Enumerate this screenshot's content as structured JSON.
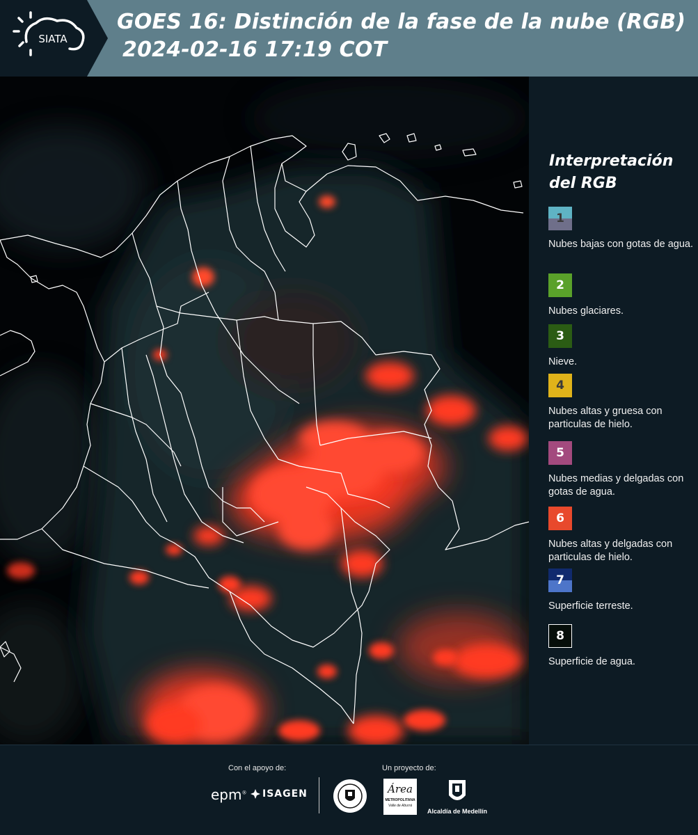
{
  "header": {
    "title_line1": "GOES 16: Distinción de la fase de la nube (RGB)",
    "title_line2": "2024-02-16 17:19 COT",
    "logo_text": "SIATA",
    "background_color": "#5f7f8b",
    "logo_panel_color": "#0d1b24"
  },
  "legend": {
    "title": "Interpretación del RGB",
    "items": [
      {
        "number": "1",
        "color_top": "#5fb3c4",
        "color_bottom": "#6f6f8a",
        "number_color": "#3a3a3a",
        "text": "Nubes bajas con gotas de agua."
      },
      {
        "number": "2",
        "color_top": "#5aa12a",
        "color_bottom": "#5aa12a",
        "number_color": "#ffffff",
        "text": "Nubes glaciares."
      },
      {
        "number": "3",
        "color_top": "#2b5c14",
        "color_bottom": "#2b5c14",
        "number_color": "#ffffff",
        "text": "Nieve."
      },
      {
        "number": "4",
        "color_top": "#e0b31a",
        "color_bottom": "#e0b31a",
        "number_color": "#3a3a3a",
        "text": "Nubes altas y gruesa con particulas de hielo."
      },
      {
        "number": "5",
        "color_top": "#a34a7e",
        "color_bottom": "#a34a7e",
        "number_color": "#ffffff",
        "text": "Nubes medias y delgadas con gotas de agua."
      },
      {
        "number": "6",
        "color_top": "#e8492c",
        "color_bottom": "#e8492c",
        "number_color": "#ffffff",
        "text": "Nubes altas y delgadas con particulas de hielo."
      },
      {
        "number": "7",
        "color_top": "#102a6e",
        "color_bottom": "#4d75c9",
        "number_color": "#ffffff",
        "text": "Superficie terreste."
      },
      {
        "number": "8",
        "color_top": "#060e0a",
        "color_bottom": "#060e0a",
        "number_color": "#ffffff",
        "text": "Superficie de agua."
      }
    ]
  },
  "footer": {
    "support_label": "Con el apoyo de:",
    "project_label": "Un proyecto de:",
    "epm": "epm",
    "isagen": "ISAGEN",
    "area_title": "Área",
    "area_sub1": "METROPOLITANA",
    "area_sub2": "Valle de Aburrá",
    "alcaldia": "Alcaldía de Medellín"
  },
  "map": {
    "cloud_color": "#ff3a22",
    "border_color": "#ffffff",
    "ocean_color": "#020406",
    "land_color": "#14232a"
  }
}
